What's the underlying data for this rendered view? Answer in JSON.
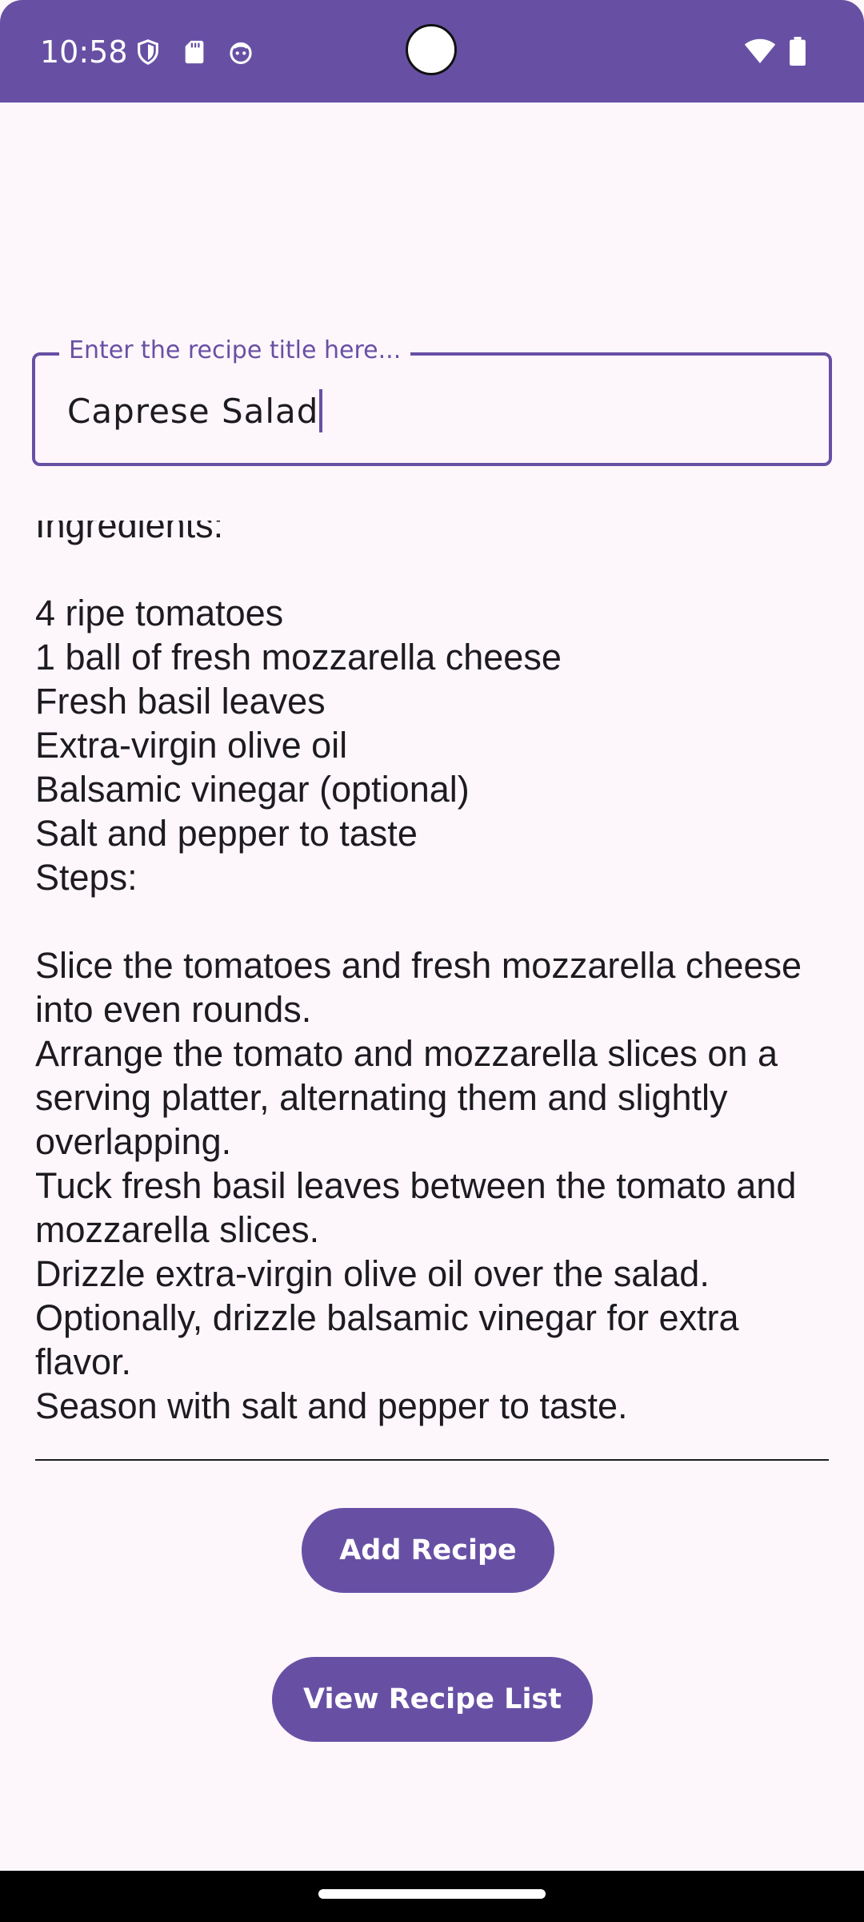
{
  "status_bar": {
    "time": "10:58",
    "icons_left": [
      "shield-icon",
      "sd-card-icon",
      "face-icon"
    ],
    "icons_right": [
      "wifi-icon",
      "battery-icon"
    ],
    "color": "#6750a4"
  },
  "title_field": {
    "label": "Enter the recipe title here...",
    "value": "Caprese Salad"
  },
  "body_field": {
    "value": "Ingredients:\n\n4 ripe tomatoes\n1 ball of fresh mozzarella cheese\nFresh basil leaves\nExtra-virgin olive oil\nBalsamic vinegar (optional)\nSalt and pepper to taste\nSteps:\n\nSlice the tomatoes and fresh mozzarella cheese into even rounds.\nArrange the tomato and mozzarella slices on a serving platter, alternating them and slightly overlapping.\nTuck fresh basil leaves between the tomato and mozzarella slices.\nDrizzle extra-virgin olive oil over the salad.\nOptionally, drizzle balsamic vinegar for extra flavor.\nSeason with salt and pepper to taste."
  },
  "buttons": {
    "add_recipe": "Add Recipe",
    "view_recipe_list": "View Recipe List"
  },
  "colors": {
    "accent": "#6750a4",
    "background": "#fdf7fc",
    "text": "#1d1b20"
  }
}
